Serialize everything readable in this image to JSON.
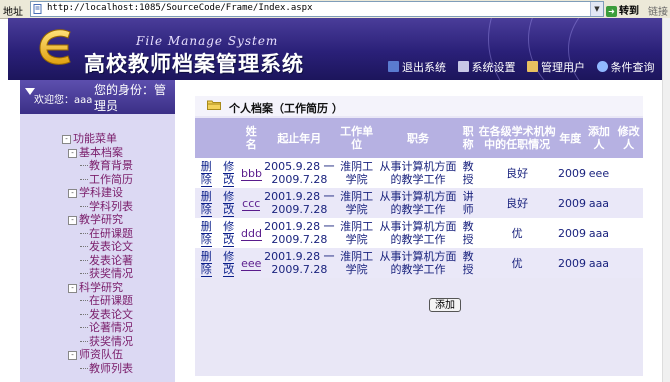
{
  "browser": {
    "address_label": "地址",
    "url": "http://localhost:1085/SourceCode/Frame/Index.aspx",
    "go_label": "转到",
    "links_label": "链接"
  },
  "header": {
    "system_name_en": "File Manage System",
    "system_name_cn": "高校教师档案管理系统",
    "toolbar": [
      {
        "label": "退出系统",
        "icon": "exit-icon",
        "color": "#5a7bd0"
      },
      {
        "label": "系统设置",
        "icon": "settings-icon",
        "color": "#d0d0e8"
      },
      {
        "label": "管理用户",
        "icon": "users-icon",
        "color": "#e8c060"
      },
      {
        "label": "条件查询",
        "icon": "search-icon",
        "color": "#90b8ff"
      }
    ]
  },
  "sidebar": {
    "welcome": "欢迎您：",
    "username": "aaa",
    "identity": "您的身份：管理员",
    "tree": [
      {
        "level": 1,
        "label": "功能菜单",
        "toggle": "-"
      },
      {
        "level": 2,
        "label": "基本档案",
        "toggle": "-"
      },
      {
        "level": 3,
        "label": "教育背景"
      },
      {
        "level": 3,
        "label": "工作简历"
      },
      {
        "level": 2,
        "label": "学科建设",
        "toggle": "-"
      },
      {
        "level": 3,
        "label": "学科列表"
      },
      {
        "level": 2,
        "label": "教学研究",
        "toggle": "-"
      },
      {
        "level": 3,
        "label": "在研课题"
      },
      {
        "level": 3,
        "label": "发表论文"
      },
      {
        "level": 3,
        "label": "发表论著"
      },
      {
        "level": 3,
        "label": "获奖情况"
      },
      {
        "level": 2,
        "label": "科学研究",
        "toggle": "-"
      },
      {
        "level": 3,
        "label": "在研课题"
      },
      {
        "level": 3,
        "label": "发表论文"
      },
      {
        "level": 3,
        "label": "论著情况"
      },
      {
        "level": 3,
        "label": "获奖情况"
      },
      {
        "level": 2,
        "label": "师资队伍",
        "toggle": "-"
      },
      {
        "level": 3,
        "label": "教师列表"
      }
    ]
  },
  "main": {
    "panel_title": "个人档案（工作简历 ）",
    "columns": [
      "",
      "",
      "姓名",
      "起止年月",
      "工作单位",
      "职务",
      "职称",
      "在各级学术机构中的任职情况",
      "年度",
      "添加人",
      "修改人"
    ],
    "rows": [
      {
        "delete": "删除",
        "edit": "修改",
        "name": "bbb",
        "period": "2005.9.28 一 2009.7.28",
        "unit": "淮阴工学院",
        "duty": "从事计算机方面的教学工作",
        "title": "教授",
        "academic": "良好",
        "year": "2009",
        "added_by": "eee",
        "modified_by": ""
      },
      {
        "delete": "删除",
        "edit": "修改",
        "name": "ccc",
        "period": "2001.9.28 一 2009.7.28",
        "unit": "淮阴工学院",
        "duty": "从事计算机方面的教学工作",
        "title": "讲师",
        "academic": "良好",
        "year": "2009",
        "added_by": "aaa",
        "modified_by": ""
      },
      {
        "delete": "删除",
        "edit": "修改",
        "name": "ddd",
        "period": "2001.9.28 一 2009.7.28",
        "unit": "淮阴工学院",
        "duty": "从事计算机方面的教学工作",
        "title": "教授",
        "academic": "优",
        "year": "2009",
        "added_by": "aaa",
        "modified_by": ""
      },
      {
        "delete": "删除",
        "edit": "修改",
        "name": "eee",
        "period": "2001.9.28 一 2009.7.28",
        "unit": "淮阴工学院",
        "duty": "从事计算机方面的教学工作",
        "title": "教授",
        "academic": "优",
        "year": "2009",
        "added_by": "aaa",
        "modified_by": ""
      }
    ],
    "add_button": "添加"
  }
}
